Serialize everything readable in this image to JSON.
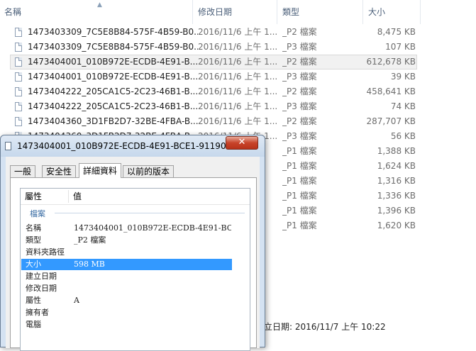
{
  "explorer": {
    "columns": {
      "name": "名稱",
      "date": "修改日期",
      "type": "類型",
      "size": "大小"
    },
    "rows": [
      {
        "name": "1473403309_7C5E8B84-575F-4B59-B0...",
        "date": "2016/11/6 上午 1...",
        "type": "_P2 檔案",
        "size": "8,475 KB"
      },
      {
        "name": "1473403309_7C5E8B84-575F-4B59-B0...",
        "date": "2016/11/6 上午 1...",
        "type": "_P3 檔案",
        "size": "107 KB"
      },
      {
        "name": "1473404001_010B972E-ECDB-4E91-B...",
        "date": "2016/11/6 上午 1...",
        "type": "_P2 檔案",
        "size": "612,678 KB",
        "selected": true
      },
      {
        "name": "1473404001_010B972E-ECDB-4E91-B...",
        "date": "2016/11/6 上午 1...",
        "type": "_P3 檔案",
        "size": "39 KB"
      },
      {
        "name": "1473404222_205CA1C5-2C23-46B1-B...",
        "date": "2016/11/6 上午 1...",
        "type": "_P2 檔案",
        "size": "458,641 KB"
      },
      {
        "name": "1473404222_205CA1C5-2C23-46B1-B...",
        "date": "2016/11/6 上午 1...",
        "type": "_P3 檔案",
        "size": "74 KB"
      },
      {
        "name": "1473404360_3D1FB2D7-32BE-4FBA-B...",
        "date": "2016/11/6 上午 1...",
        "type": "_P2 檔案",
        "size": "287,707 KB"
      },
      {
        "name": "1473404360_3D1FB2D7-32BE-4FBA-B...",
        "date": "2016/11/6 上午 1...",
        "type": "_P3 檔案",
        "size": "56 KB"
      },
      {
        "name": "",
        "date": "",
        "type": "_P1 檔案",
        "size": "1,388 KB"
      },
      {
        "name": "",
        "date": "",
        "type": "_P1 檔案",
        "size": "1,624 KB"
      },
      {
        "name": "",
        "date": "",
        "type": "_P1 檔案",
        "size": "1,316 KB"
      },
      {
        "name": "",
        "date": "",
        "type": "_P1 檔案",
        "size": "1,336 KB"
      },
      {
        "name": "",
        "date": "",
        "type": "_P1 檔案",
        "size": "1,396 KB"
      },
      {
        "name": "",
        "date": "",
        "type": "_P1 檔案",
        "size": "1,620 KB"
      }
    ],
    "status_date": "立日期: 2016/11/7 上午 10:22"
  },
  "dialog": {
    "title": "1473404001_010B972E-ECDB-4E91-BCE1-911905...",
    "close_label": "✕",
    "tabs": [
      "一般",
      "安全性",
      "詳細資料",
      "以前的版本"
    ],
    "active_tab": 2,
    "header": {
      "property": "屬性",
      "value": "值"
    },
    "group": "檔案",
    "properties": [
      {
        "name": "名稱",
        "value": "1473404001_010B972E-ECDB-4E91-BCE..."
      },
      {
        "name": "類型",
        "value": "_P2 檔案"
      },
      {
        "name": "資料夾路徑",
        "value": ""
      },
      {
        "name": "大小",
        "value": "598 MB",
        "selected": true
      },
      {
        "name": "建立日期",
        "value": ""
      },
      {
        "name": "修改日期",
        "value": ""
      },
      {
        "name": "屬性",
        "value": "A"
      },
      {
        "name": "擁有者",
        "value": ""
      },
      {
        "name": "電腦",
        "value": ""
      }
    ]
  },
  "colors": {
    "selection": "#3399ff",
    "group_label": "#3b6ea5",
    "header_text": "#4c607a"
  }
}
